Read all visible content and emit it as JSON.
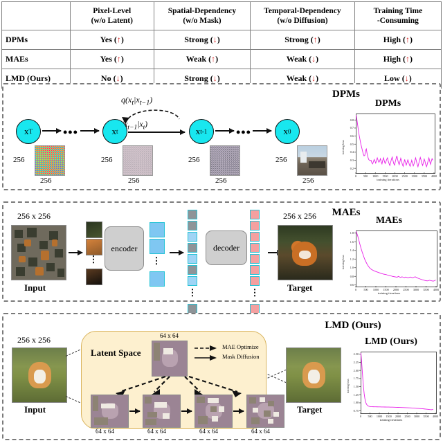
{
  "table": {
    "columns": [
      "",
      "Pixel-Level\n(w/o Latent)",
      "Spatial-Dependency\n(w/o Mask)",
      "Temporal-Dependency\n(w/o Diffusion)",
      "Training Time\n-Consuming"
    ],
    "col1_l1": "Pixel-Level",
    "col1_l2": "(w/o Latent)",
    "col2_l1": "Spatial-Dependency",
    "col2_l2": "(w/o Mask)",
    "col3_l1": "Temporal-Dependency",
    "col3_l2": "(w/o Diffusion)",
    "col4_l1": "Training Time",
    "col4_l2": "-Consuming",
    "rows": [
      {
        "name": "DPMs",
        "c1": "Yes",
        "a1": "up",
        "c2": "Strong",
        "a2": "down",
        "c3": "Strong",
        "a3": "up",
        "c4": "High",
        "a4": "up"
      },
      {
        "name": "MAEs",
        "c1": "Yes",
        "a1": "up",
        "c2": "Weak",
        "a2": "up",
        "c3": "Weak",
        "a3": "down",
        "c4": "High",
        "a4": "up"
      },
      {
        "name": "LMD (Ours)",
        "c1": "No",
        "a1": "down",
        "c2": "Strong",
        "a2": "down",
        "c3": "Weak",
        "a3": "down",
        "c4": "Low",
        "a4": "down"
      }
    ],
    "arrow_up_glyph": "↑",
    "arrow_down_glyph": "↓",
    "arrow_color": "#d81c1c"
  },
  "dpms": {
    "title": "DPMs",
    "nodes": [
      "x_T",
      "x_t",
      "x_t-1",
      "x_0"
    ],
    "node_labels": {
      "n1": "x",
      "n1sub": "T",
      "n2": "x",
      "n2sub": "t",
      "n3": "x",
      "n3sub": "t-1",
      "n4": "x",
      "n4sub": "0"
    },
    "forward_eq": "q(x_t|x_{t-1})",
    "reverse_eq": "p_θ(x_{t-1}|x_t)",
    "ellipsis": "•••",
    "dim_left": "256",
    "dim_bottom": "256"
  },
  "maes": {
    "title": "MAEs",
    "input_dim": "256 x 256",
    "target_dim": "256 x 256",
    "input_label": "Input",
    "target_label": "Target",
    "encoder_label": "encoder",
    "decoder_label": "decoder",
    "vdots": "⋮"
  },
  "lmd": {
    "title": "LMD (Ours)",
    "input_dim": "256 x 256",
    "target_dim": "256 x 256",
    "input_label": "Input",
    "target_label": "Target",
    "latent_space_label": "Latent Space",
    "top_latent_dim": "64 x 64",
    "latent_dims": [
      "64 x 64",
      "64 x 64",
      "64 x 64",
      "64 x 64"
    ],
    "legend": [
      {
        "style": "dashed",
        "label": "MAE Optimize"
      },
      {
        "style": "solid",
        "label": "Mask Diffusion"
      }
    ]
  },
  "chart_data": [
    {
      "id": "dpms_chart",
      "type": "line",
      "title": "DPMs",
      "xlabel": "training iterations",
      "ylabel": "training loss",
      "xlim": [
        0,
        4000
      ],
      "ylim": [
        0.15,
        0.88
      ],
      "xticks": [
        0,
        500,
        1000,
        1500,
        2000,
        2500,
        3000,
        3500,
        4000
      ],
      "yticks": [
        0.2,
        0.3,
        0.4,
        0.5,
        0.6,
        0.7,
        0.8
      ],
      "line_color": "#e81ee8",
      "grid": false,
      "x": [
        20,
        60,
        100,
        140,
        180,
        220,
        260,
        300,
        340,
        380,
        420,
        460,
        500,
        540,
        580,
        620,
        660,
        700,
        740,
        780,
        820,
        860,
        900,
        940,
        980,
        1020,
        1060,
        1100,
        1140,
        1180,
        1220,
        1260,
        1300,
        1340,
        1380,
        1420,
        1460,
        1500,
        1540,
        1580,
        1620,
        1660,
        1700,
        1740,
        1780,
        1820,
        1860,
        1900,
        1940,
        1980,
        2020,
        2060,
        2100,
        2140,
        2180,
        2220,
        2260,
        2300,
        2340,
        2380,
        2420,
        2460,
        2500,
        2540,
        2580,
        2620,
        2660,
        2700,
        2740,
        2780,
        2820,
        2860,
        2900,
        2940,
        2980,
        3020,
        3060,
        3100,
        3140,
        3180,
        3220,
        3260,
        3300,
        3340,
        3380,
        3420,
        3460,
        3500,
        3540,
        3580,
        3620,
        3660,
        3700,
        3740,
        3780,
        3820,
        3860,
        3900,
        3940
      ],
      "y": [
        0.86,
        0.8,
        0.73,
        0.66,
        0.6,
        0.55,
        0.5,
        0.46,
        0.42,
        0.38,
        0.355,
        0.36,
        0.42,
        0.44,
        0.38,
        0.34,
        0.31,
        0.3,
        0.295,
        0.3,
        0.27,
        0.255,
        0.28,
        0.31,
        0.29,
        0.265,
        0.3,
        0.33,
        0.3,
        0.275,
        0.29,
        0.32,
        0.28,
        0.255,
        0.3,
        0.33,
        0.29,
        0.26,
        0.28,
        0.31,
        0.33,
        0.29,
        0.26,
        0.235,
        0.27,
        0.31,
        0.34,
        0.3,
        0.26,
        0.24,
        0.28,
        0.32,
        0.355,
        0.31,
        0.27,
        0.245,
        0.285,
        0.325,
        0.29,
        0.25,
        0.225,
        0.265,
        0.31,
        0.275,
        0.24,
        0.27,
        0.305,
        0.28,
        0.245,
        0.225,
        0.26,
        0.3,
        0.265,
        0.23,
        0.255,
        0.295,
        0.33,
        0.29,
        0.25,
        0.22,
        0.26,
        0.3,
        0.335,
        0.3,
        0.26,
        0.235,
        0.275,
        0.315,
        0.285,
        0.245,
        0.22,
        0.255,
        0.295,
        0.33,
        0.29,
        0.25,
        0.285,
        0.32,
        0.3
      ]
    },
    {
      "id": "maes_chart",
      "type": "line",
      "title": "MAEs",
      "xlabel": "training iterations",
      "ylabel": "training loss",
      "xlim": [
        0,
        4000
      ],
      "ylim": [
        0.58,
        1.86
      ],
      "xticks": [
        0,
        500,
        1000,
        1500,
        2000,
        2500,
        3000,
        3500,
        4000
      ],
      "yticks": [
        0.6,
        0.8,
        1.0,
        1.2,
        1.4,
        1.6,
        1.8
      ],
      "line_color": "#e81ee8",
      "grid": false,
      "x": [
        20,
        80,
        140,
        200,
        260,
        320,
        380,
        440,
        500,
        560,
        620,
        680,
        740,
        800,
        860,
        920,
        980,
        1040,
        1100,
        1160,
        1220,
        1280,
        1340,
        1400,
        1460,
        1520,
        1580,
        1640,
        1700,
        1760,
        1820,
        1880,
        1940,
        2000,
        2060,
        2120,
        2180,
        2240,
        2300,
        2360,
        2420,
        2480,
        2540,
        2600,
        2660,
        2720,
        2780,
        2840,
        2900,
        2960,
        3020,
        3080,
        3140,
        3200,
        3260,
        3320,
        3380,
        3440,
        3500,
        3560,
        3620,
        3680,
        3740,
        3800,
        3860,
        3920,
        3980
      ],
      "y": [
        1.84,
        1.76,
        1.66,
        1.55,
        1.45,
        1.36,
        1.28,
        1.2,
        1.14,
        1.085,
        1.04,
        1.0,
        0.975,
        0.955,
        0.94,
        0.925,
        0.915,
        0.905,
        0.895,
        0.885,
        0.875,
        0.865,
        0.858,
        0.85,
        0.845,
        0.84,
        0.83,
        0.822,
        0.815,
        0.81,
        0.8,
        0.795,
        0.79,
        0.785,
        0.78,
        0.8,
        0.785,
        0.775,
        0.79,
        0.78,
        0.77,
        0.785,
        0.775,
        0.765,
        0.775,
        0.785,
        0.775,
        0.765,
        0.78,
        0.79,
        0.775,
        0.76,
        0.75,
        0.74,
        0.73,
        0.72,
        0.715,
        0.705,
        0.7,
        0.695,
        0.7,
        0.71,
        0.7,
        0.695,
        0.69,
        0.7,
        0.715
      ]
    },
    {
      "id": "lmd_chart",
      "type": "line",
      "title": "LMD (Ours)",
      "xlabel": "training iterations",
      "ylabel": "training loss",
      "xlim": [
        0,
        4000
      ],
      "ylim": [
        0.7,
        2.58
      ],
      "xticks": [
        0,
        500,
        1000,
        1500,
        2000,
        2500,
        3000,
        3500,
        4000
      ],
      "yticks": [
        0.75,
        1.0,
        1.25,
        1.5,
        1.75,
        2.0,
        2.25,
        2.5
      ],
      "line_color": "#e81ee8",
      "grid": false,
      "x": [
        15,
        50,
        85,
        120,
        155,
        190,
        225,
        260,
        300,
        340,
        380,
        420,
        460,
        500,
        560,
        620,
        680,
        740,
        800,
        880,
        960,
        1040,
        1120,
        1200,
        1300,
        1400,
        1500,
        1600,
        1700,
        1800,
        1900,
        2000,
        2100,
        2200,
        2300,
        2400,
        2500,
        2600,
        2700,
        2800,
        2900,
        3000,
        3100,
        3200,
        3300,
        3400,
        3500,
        3600,
        3700,
        3800,
        3880
      ],
      "y": [
        2.54,
        2.3,
        2.0,
        1.72,
        1.48,
        1.28,
        1.14,
        1.04,
        0.975,
        0.935,
        0.91,
        0.898,
        0.89,
        0.885,
        0.882,
        0.88,
        0.879,
        0.878,
        0.877,
        0.876,
        0.875,
        0.874,
        0.873,
        0.872,
        0.871,
        0.87,
        0.869,
        0.868,
        0.866,
        0.864,
        0.862,
        0.86,
        0.858,
        0.856,
        0.854,
        0.851,
        0.848,
        0.845,
        0.842,
        0.838,
        0.834,
        0.83,
        0.826,
        0.822,
        0.818,
        0.812,
        0.806,
        0.8,
        0.793,
        0.788,
        0.8
      ]
    }
  ]
}
